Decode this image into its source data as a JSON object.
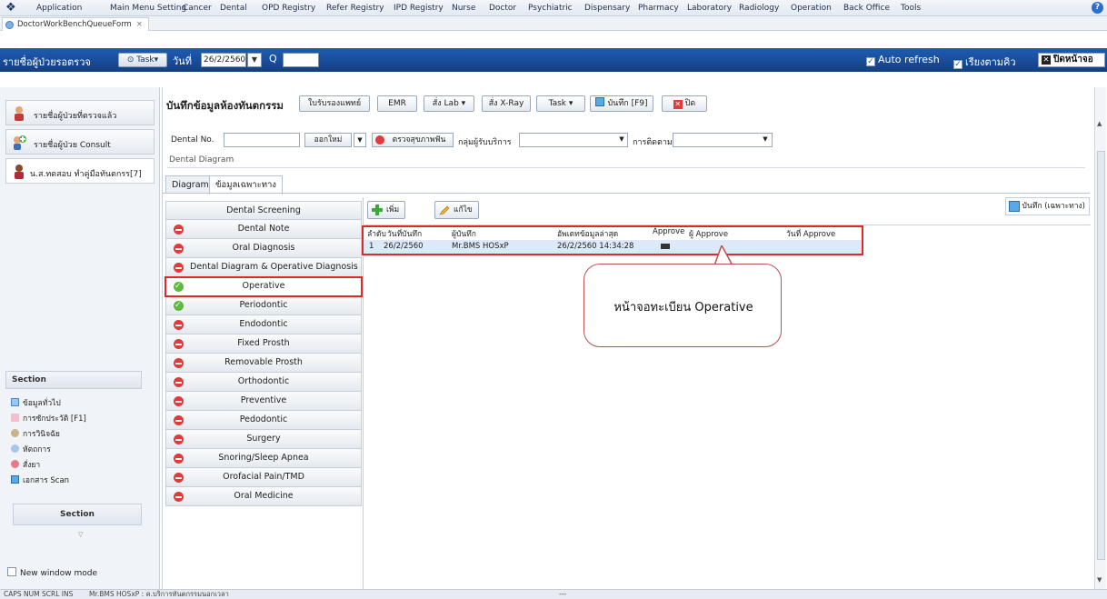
{
  "menu": [
    "Application",
    "Main Menu Setting",
    "Cancer",
    "Dental",
    "OPD Registry",
    "Refer Registry",
    "IPD Registry",
    "Nurse",
    "Doctor",
    "Psychiatric",
    "Dispensary",
    "Pharmacy",
    "Laboratory",
    "Radiology",
    "Operation",
    "Back Office",
    "Tools"
  ],
  "doc_tab": "DoctorWorkBenchQueueForm",
  "toolbar": {
    "title": "รายชื่อผู้ป่วยรอตรวจ",
    "task": "Task",
    "date_label": "วันที่",
    "date_value": "26/2/2560",
    "q_label": "Q",
    "auto_refresh": "Auto refresh",
    "sort_queue": "เรียงตามคิว",
    "close": "ปิดหน้าจอ"
  },
  "left": {
    "items": [
      "รายชื่อผู้ป่วยที่ตรวจแล้ว",
      "รายชื่อผู้ป่วย Consult",
      "น.ส.ทดสอบ ทำคู่มือทันตกรร[7]"
    ],
    "section_title": "Section",
    "section_items": [
      "ข้อมูลทั่วไป",
      "การซักประวัติ [F1]",
      "การวินิจฉัย",
      "หัตถการ",
      "สั่งยา",
      "เอกสาร Scan"
    ],
    "section_button": "Section",
    "new_window": "New window mode"
  },
  "main": {
    "title": "บันทึกข้อมูลห้องทันตกรรม",
    "buttons": [
      "ใบรับรองแพทย์",
      "EMR",
      "สั่ง Lab",
      "สั่ง X-Ray",
      "Task",
      "บันทึก [F9]",
      "ปิด"
    ],
    "dental_no_label": "Dental No.",
    "new_no": "ออกใหม่",
    "oral_check": "ตรวจสุขภาพฟัน",
    "service_group": "กลุ่มผู้รับบริการ",
    "follow_up": "การติดตาม",
    "diagram_label": "Dental Diagram",
    "tabs": [
      "Diagram",
      "ข้อมูลเฉพาะทาง"
    ]
  },
  "categories": [
    {
      "label": "Dental Screening",
      "status": "none"
    },
    {
      "label": "Dental Note",
      "status": "red"
    },
    {
      "label": "Oral Diagnosis",
      "status": "red"
    },
    {
      "label": "Dental Diagram & Operative Diagnosis",
      "status": "red"
    },
    {
      "label": "Operative",
      "status": "green"
    },
    {
      "label": "Periodontic",
      "status": "green"
    },
    {
      "label": "Endodontic",
      "status": "red"
    },
    {
      "label": "Fixed Prosth",
      "status": "red"
    },
    {
      "label": "Removable Prosth",
      "status": "red"
    },
    {
      "label": "Orthodontic",
      "status": "red"
    },
    {
      "label": "Preventive",
      "status": "red"
    },
    {
      "label": "Pedodontic",
      "status": "red"
    },
    {
      "label": "Surgery",
      "status": "red"
    },
    {
      "label": "Snoring/Sleep Apnea",
      "status": "red"
    },
    {
      "label": "Orofacial Pain/TMD",
      "status": "red"
    },
    {
      "label": "Oral Medicine",
      "status": "red"
    }
  ],
  "content": {
    "add": "เพิ่ม",
    "edit": "แก้ไข",
    "save_specific": "บันทึก (เฉพาะทาง)",
    "columns": [
      "ลำดับ",
      "วันที่บันทึก",
      "ผู้บันทึก",
      "อัพเดทข้อมูลล่าสุด",
      "Approve",
      "ผู้ Approve",
      "วันที่ Approve"
    ],
    "rows": [
      [
        "1",
        "26/2/2560",
        "Mr.BMS HOSxP",
        "26/2/2560 14:34:28",
        "",
        "",
        ""
      ]
    ],
    "callout": "หน้าจอทะเบียน Operative"
  },
  "status_bar": {
    "keys": "CAPS  NUM  SCRL  INS",
    "user": "Mr.BMS HOSxP : ค.บริการทันตกรรมนอกเวลา",
    "extra": "---"
  }
}
